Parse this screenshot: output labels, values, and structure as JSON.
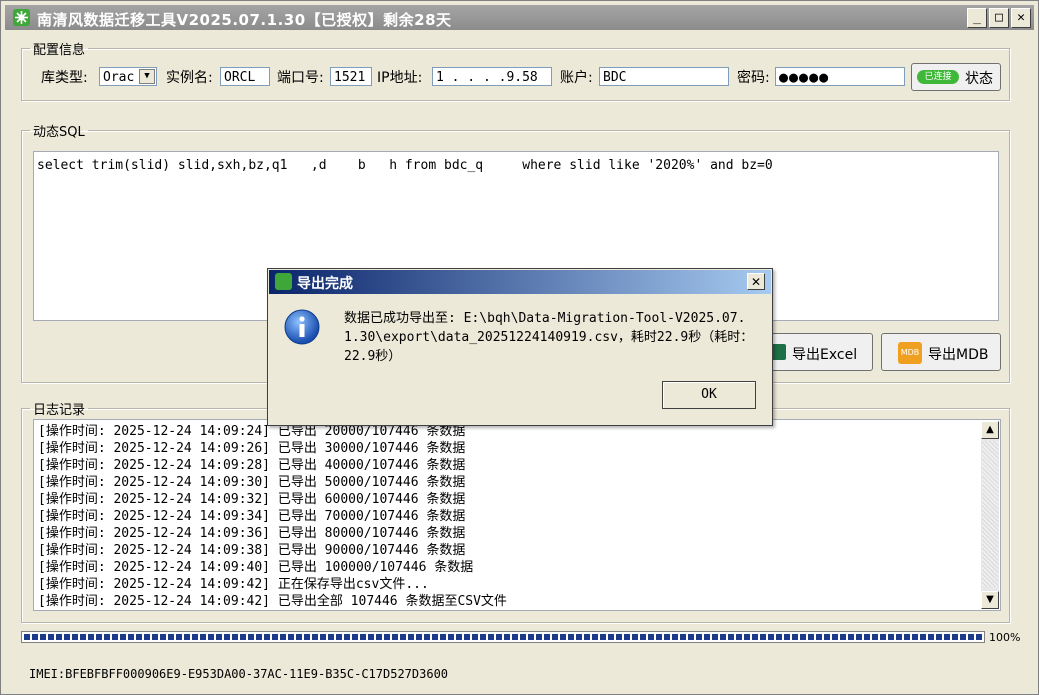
{
  "window": {
    "title": "南清风数据迁移工具V2025.07.1.30【已授权】剩余28天",
    "minimize": "_",
    "maximize": "□",
    "close": "✕"
  },
  "config": {
    "legend": "配置信息",
    "db_type_label": "库类型:",
    "db_type_value": "Orac",
    "instance_label": "实例名:",
    "instance_value": "ORCL",
    "port_label": "端口号:",
    "port_value": "1521",
    "ip_label": "IP地址:",
    "ip_value": "1 . . . .9.58",
    "account_label": "账户:",
    "account_value": "BDC",
    "password_label": "密码:",
    "password_value": "●●●●●",
    "status_badge": "已连接",
    "status_button": "状态"
  },
  "sql": {
    "legend": "动态SQL",
    "text": "select trim(slid) slid,sxh,bz,q1   ,d    b   h from bdc_q     where slid like '2020%' and bz=0"
  },
  "export": {
    "excel_label": "导出Excel",
    "mdb_label": "导出MDB",
    "mdb_icon_text": "MDB"
  },
  "log": {
    "legend": "日志记录",
    "lines": [
      "[操作时间: 2025-12-24 14:09:24] 已导出 20000/107446 条数据",
      "[操作时间: 2025-12-24 14:09:26] 已导出 30000/107446 条数据",
      "[操作时间: 2025-12-24 14:09:28] 已导出 40000/107446 条数据",
      "[操作时间: 2025-12-24 14:09:30] 已导出 50000/107446 条数据",
      "[操作时间: 2025-12-24 14:09:32] 已导出 60000/107446 条数据",
      "[操作时间: 2025-12-24 14:09:34] 已导出 70000/107446 条数据",
      "[操作时间: 2025-12-24 14:09:36] 已导出 80000/107446 条数据",
      "[操作时间: 2025-12-24 14:09:38] 已导出 90000/107446 条数据",
      "[操作时间: 2025-12-24 14:09:40] 已导出 100000/107446 条数据",
      "[操作时间: 2025-12-24 14:09:42] 正在保存导出csv文件...",
      "[操作时间: 2025-12-24 14:09:42] 已导出全部 107446 条数据至CSV文件"
    ]
  },
  "progress": {
    "value_pct": 100,
    "label": "100%"
  },
  "imei": "IMEI:BFEBFBFF000906E9-E953DA00-37AC-11E9-B35C-C17D527D3600",
  "dialog": {
    "title": "导出完成",
    "close": "✕",
    "message": "数据已成功导出至: E:\\bqh\\Data-Migration-Tool-V2025.07.1.30\\export\\data_20251224140919.csv，耗时22.9秒（耗时：22.9秒）",
    "ok_label": "OK"
  },
  "colors": {
    "titlebar": "#9c9c9c",
    "dialog_title": "#0a246a",
    "progress": "#1c3a8a",
    "badge": "#3fb83a"
  }
}
